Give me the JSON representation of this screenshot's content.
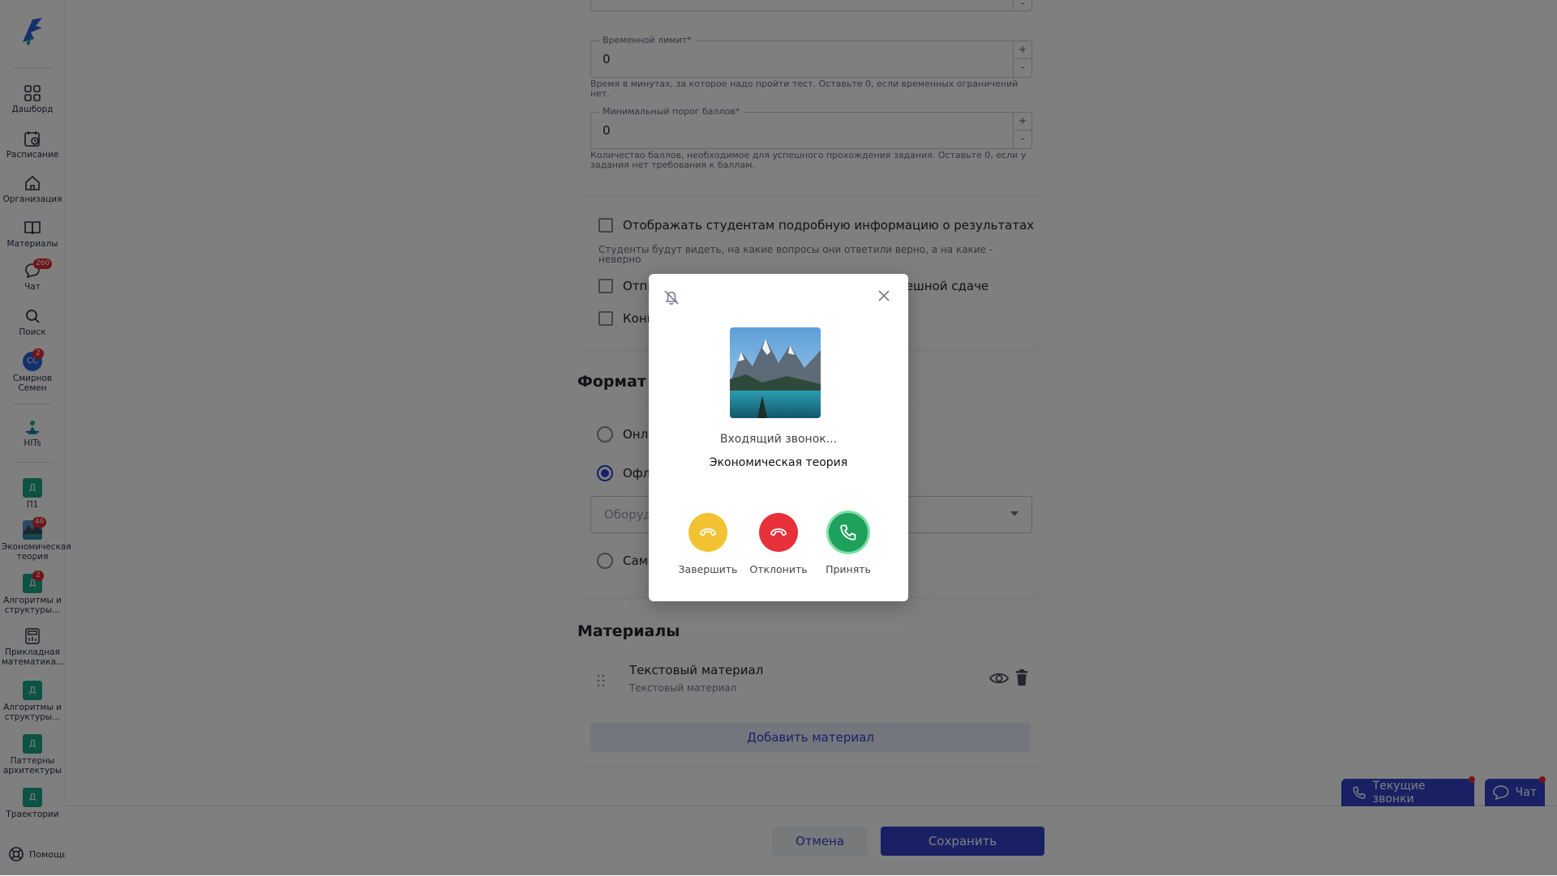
{
  "sidebar": {
    "items": [
      {
        "label": "Дашборд",
        "icon": "dashboard-icon"
      },
      {
        "label": "Расписание",
        "icon": "calendar-icon"
      },
      {
        "label": "Организация",
        "icon": "home-icon"
      },
      {
        "label": "Материалы",
        "icon": "book-icon"
      },
      {
        "label": "Чат",
        "icon": "chat-icon",
        "badge": "260"
      },
      {
        "label": "Поиск",
        "icon": "search-icon"
      },
      {
        "label": "Смирнов Семен",
        "avatar": "СС",
        "badge": "2"
      }
    ],
    "hits_label": "HITs",
    "courses": [
      {
        "tile": "Д",
        "label": "П1"
      },
      {
        "label": "Экономическая теория",
        "badge": "46"
      },
      {
        "tile": "Д",
        "label": "Алгоритмы и структуры...",
        "badge": "2"
      },
      {
        "label": "Прикладная математика..."
      },
      {
        "tile": "Д",
        "label": "Алгоритмы и структуры..."
      },
      {
        "tile": "Д",
        "label": "Паттерны архитектуры"
      },
      {
        "tile": "Д",
        "label": "Траектории"
      }
    ],
    "help_label": "Помощь"
  },
  "form": {
    "time_limit": {
      "label": "Временной лимит*",
      "value": "0",
      "hint": "Время в минутах, за которое надо пройти тест. Оставьте 0, если временных ограничений нет."
    },
    "min_score": {
      "label": "Минимальный порог баллов*",
      "value": "0",
      "hint": "Количество баллов, необходимое для успешного прохождения задания. Оставьте 0, если у задания нет требования к баллам."
    },
    "stepper_plus": "+",
    "stepper_minus": "-",
    "show_results": {
      "label": "Отображать студентам подробную информацию о результатах",
      "hint": "Студенты будут видеть, на какие вопросы они ответили верно, а на какие - неверно"
    },
    "send_option_left": "Отпр",
    "send_option_right": "пешной сдаче",
    "convert_option": "Конв",
    "format_title_partial": "Формат ат",
    "format_options": {
      "online": "Онла",
      "offline": "Офла",
      "self": "Само"
    },
    "equipment_placeholder": "Оборудо"
  },
  "materials": {
    "title": "Материалы",
    "item_title": "Текстовый материал",
    "item_subtitle": "Текстовый материал",
    "add_label": "Добавить материал"
  },
  "footer": {
    "cancel": "Отмена",
    "save": "Сохранить"
  },
  "floating": {
    "calls": "Текущие звонки",
    "chat": "Чат"
  },
  "call_modal": {
    "status": "Входящий звонок...",
    "name": "Экономическая теория",
    "end_label": "Завершить",
    "decline_label": "Отклонить",
    "accept_label": "Принять"
  },
  "colors": {
    "primary": "#3343c9",
    "end": "#f2c233",
    "decline": "#e8303a",
    "accept": "#1fa15e",
    "badge": "#e0282e",
    "tile": "#1aa68a"
  }
}
